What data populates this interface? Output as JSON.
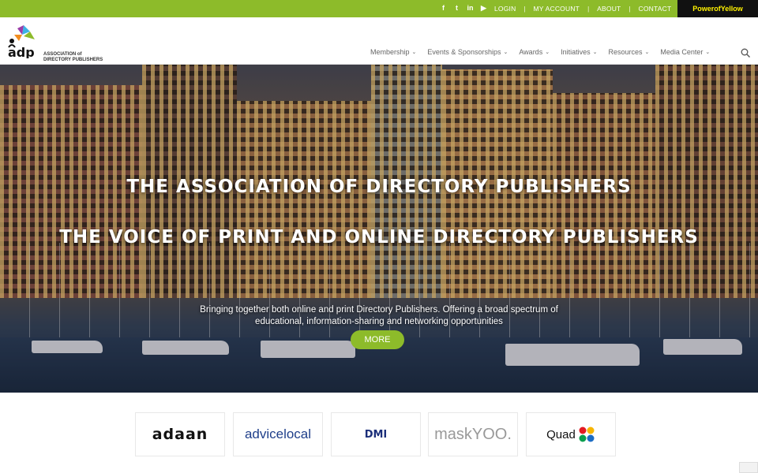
{
  "social": {
    "icons": [
      "facebook-icon",
      "twitter-icon",
      "linkedin-icon",
      "youtube-icon"
    ],
    "glyphs": [
      "f",
      "t",
      "in",
      "▶"
    ]
  },
  "toplinks": [
    "LOGIN",
    "MY ACCOUNT",
    "ABOUT",
    "CONTACT"
  ],
  "toplink_separator": "|",
  "power_of_yellow": "PowerofYellow",
  "logo": {
    "text": "adp",
    "line1": "ASSOCIATION of",
    "line2": "DIRECTORY PUBLISHERS"
  },
  "nav": [
    "Membership",
    "Events & Sponsorships",
    "Awards",
    "Initiatives",
    "Resources",
    "Media Center"
  ],
  "hero": {
    "title1": "THE ASSOCIATION OF DIRECTORY PUBLISHERS",
    "title2": "THE VOICE OF PRINT AND ONLINE DIRECTORY PUBLISHERS",
    "description": "Bringing together both online and print Directory Publishers. Offering a broad spectrum of educational, information-sharing and networking opportunities",
    "button": "MORE"
  },
  "sponsors": [
    "adaan",
    "advicelocal",
    "DMI",
    "maskYOO.",
    "Quad"
  ],
  "colors": {
    "accent": "#8dbb2a",
    "brand_dark": "#111111",
    "yellow": "#fff200"
  }
}
